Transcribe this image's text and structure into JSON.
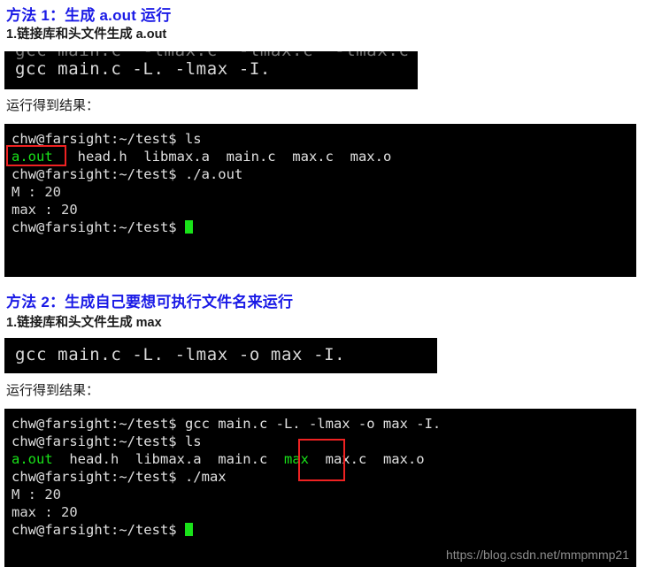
{
  "document": {
    "background_color": "#ffffff",
    "heading_color": "#1a1ae6",
    "terminal_bg": "#000000",
    "terminal_fg": "#d8d8d8",
    "highlight_color": "#19e219",
    "annotation_color": "#ef2222"
  },
  "section1": {
    "method_title": "方法 1：生成 a.out 运行",
    "step_title": "1.链接库和头文件生成 a.out",
    "result_label": "运行得到结果：",
    "command_block": {
      "clipped_line": "gcc main.c  -lmax.c  -lmax.c  -lmax.c",
      "command": "gcc main.c -L. -lmax -I."
    },
    "terminal": {
      "lines": [
        {
          "prompt": "chw@farsight:~/test$ ",
          "command": "ls"
        },
        {
          "listing": "a.out   head.h  libmax.a  main.c  max.c  max.o"
        },
        {
          "prompt": "chw@farsight:~/test$ ",
          "command": "./a.out"
        },
        {
          "output": "M : 20"
        },
        {
          "output": "max : 20"
        },
        {
          "prompt": "chw@farsight:~/test$ ",
          "cursor": true
        }
      ],
      "listing_parts": {
        "highlighted": "a.out",
        "rest": "   head.h  libmax.a  main.c  max.c  max.o"
      },
      "annotation": "a.out"
    }
  },
  "section2": {
    "method_title": "方法 2：生成自己要想可执行文件名来运行",
    "step_title": "1.链接库和头文件生成 max",
    "result_label": "运行得到结果：",
    "command_block": {
      "command": "gcc main.c -L. -lmax -o max -I."
    },
    "terminal": {
      "lines": [
        {
          "prompt": "chw@farsight:~/test$ ",
          "command": "gcc main.c -L. -lmax -o max -I."
        },
        {
          "prompt": "chw@farsight:~/test$ ",
          "command": "ls"
        },
        {
          "listing": "a.out  head.h  libmax.a  main.c  max  max.c  max.o"
        },
        {
          "prompt": "chw@farsight:~/test$ ",
          "command": "./max"
        },
        {
          "output": "M : 20"
        },
        {
          "output": "max : 20"
        },
        {
          "prompt": "chw@farsight:~/test$ ",
          "cursor": true
        }
      ],
      "listing_parts": {
        "highlighted_first": "a.out",
        "middle": "  head.h  libmax.a  main.c  ",
        "highlighted_second": "max",
        "rest": "  max.c  max.o"
      },
      "annotation": "max"
    }
  },
  "watermark": {
    "text": "https://blog.csdn.net/mmpmmp21"
  }
}
